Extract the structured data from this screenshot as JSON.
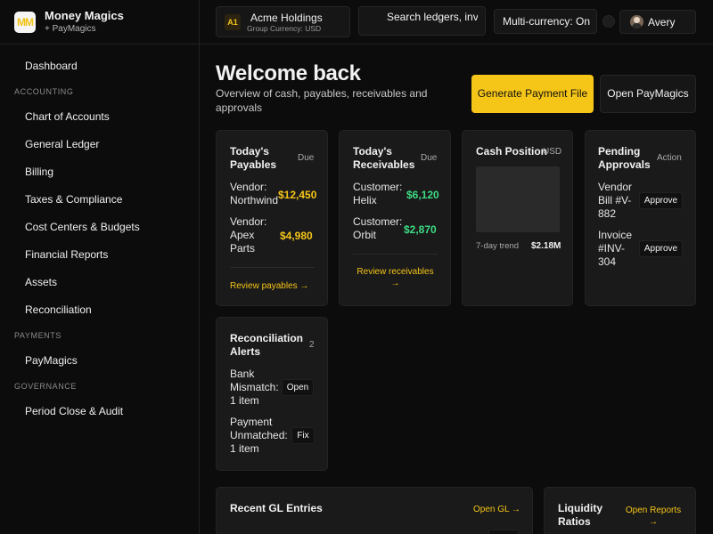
{
  "brand": {
    "logo_text": "MM",
    "name": "Money Magics",
    "sub": "+ PayMagics"
  },
  "topbar": {
    "company_badge": "A1",
    "company_name": "Acme Holdings",
    "company_currency": "Group Currency: USD",
    "search_placeholder": "Search ledgers, inv",
    "currency_toggle": "Multi-currency: On",
    "user_name": "Avery"
  },
  "sidebar": {
    "dashboard": "Dashboard",
    "sections": {
      "accounting": "ACCOUNTING",
      "payments": "PAYMENTS",
      "governance": "GOVERNANCE"
    },
    "items": {
      "chart_of_accounts": "Chart of Accounts",
      "general_ledger": "General Ledger",
      "billing": "Billing",
      "taxes": "Taxes & Compliance",
      "cost_centers": "Cost Centers & Budgets",
      "financial_reports": "Financial Reports",
      "assets": "Assets",
      "reconciliation": "Reconciliation",
      "paymagics": "PayMagics",
      "period_close": "Period Close & Audit"
    }
  },
  "header": {
    "title": "Welcome back",
    "subtitle": "Overview of cash, payables, receivables and approvals",
    "primary_button": "Generate Payment File",
    "secondary_button": "Open PayMagics"
  },
  "cards": {
    "payables": {
      "title": "Today's Payables",
      "tag": "Due",
      "row1_label": "Vendor: Northwind",
      "row1_amount": "$12,450",
      "row2_label": "Vendor: Apex Parts",
      "row2_amount": "$4,980",
      "link": "Review payables →"
    },
    "receivables": {
      "title": "Today's Receivables",
      "tag": "Due",
      "row1_label": "Customer: Helix",
      "row1_amount": "$6,120",
      "row2_label": "Customer: Orbit",
      "row2_amount": "$2,870",
      "link": "Review receivables →"
    },
    "cash": {
      "title": "Cash Position",
      "tag": "USD",
      "trend_label": "7-day trend",
      "trend_value": "$2.18M"
    },
    "approvals": {
      "title": "Pending Approvals",
      "tag": "Action",
      "row1_label": "Vendor Bill #V-882",
      "row1_button": "Approve",
      "row2_label": "Invoice #INV-304",
      "row2_button": "Approve"
    },
    "reconciliation": {
      "title": "Reconciliation Alerts",
      "count": "2",
      "row1_label": "Bank Mismatch: 1 item",
      "row1_button": "Open",
      "row2_label": "Payment Unmatched: 1 item",
      "row2_button": "Fix"
    },
    "gl_entries": {
      "title": "Recent GL Entries",
      "link": "Open GL →"
    },
    "liquidity": {
      "title": "Liquidity Ratios",
      "link": "Open Reports →"
    }
  },
  "colors": {
    "accent": "#f5c518",
    "positive": "#3ddc84",
    "background": "#0c0c0c",
    "card": "#1a1a1a"
  }
}
